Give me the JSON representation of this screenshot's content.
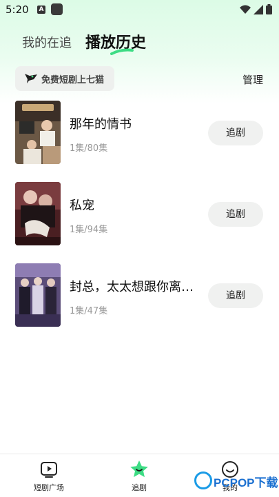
{
  "status": {
    "time": "5:20",
    "notification_letter": "A"
  },
  "tabs": {
    "mine": "我的在追",
    "history": "播放历史"
  },
  "promo": {
    "text": "免费短剧上七猫"
  },
  "manage_label": "管理",
  "history_items": [
    {
      "title": "那年的情书",
      "episodes": "1集/80集",
      "button": "追剧"
    },
    {
      "title": "私宠",
      "episodes": "1集/94集",
      "button": "追剧"
    },
    {
      "title": "封总，太太想跟你离…",
      "episodes": "1集/47集",
      "button": "追剧"
    }
  ],
  "bottom_nav": [
    {
      "label": "短剧广场",
      "icon": "play-icon"
    },
    {
      "label": "追剧",
      "icon": "star-icon"
    },
    {
      "label": "我的",
      "icon": "smile-icon"
    }
  ],
  "watermark": {
    "text": "PCPOP下载"
  },
  "colors": {
    "accent_green": "#2ecc71",
    "header_gradient": "#dcfbe6",
    "watermark_blue": "#1a6fd0"
  }
}
